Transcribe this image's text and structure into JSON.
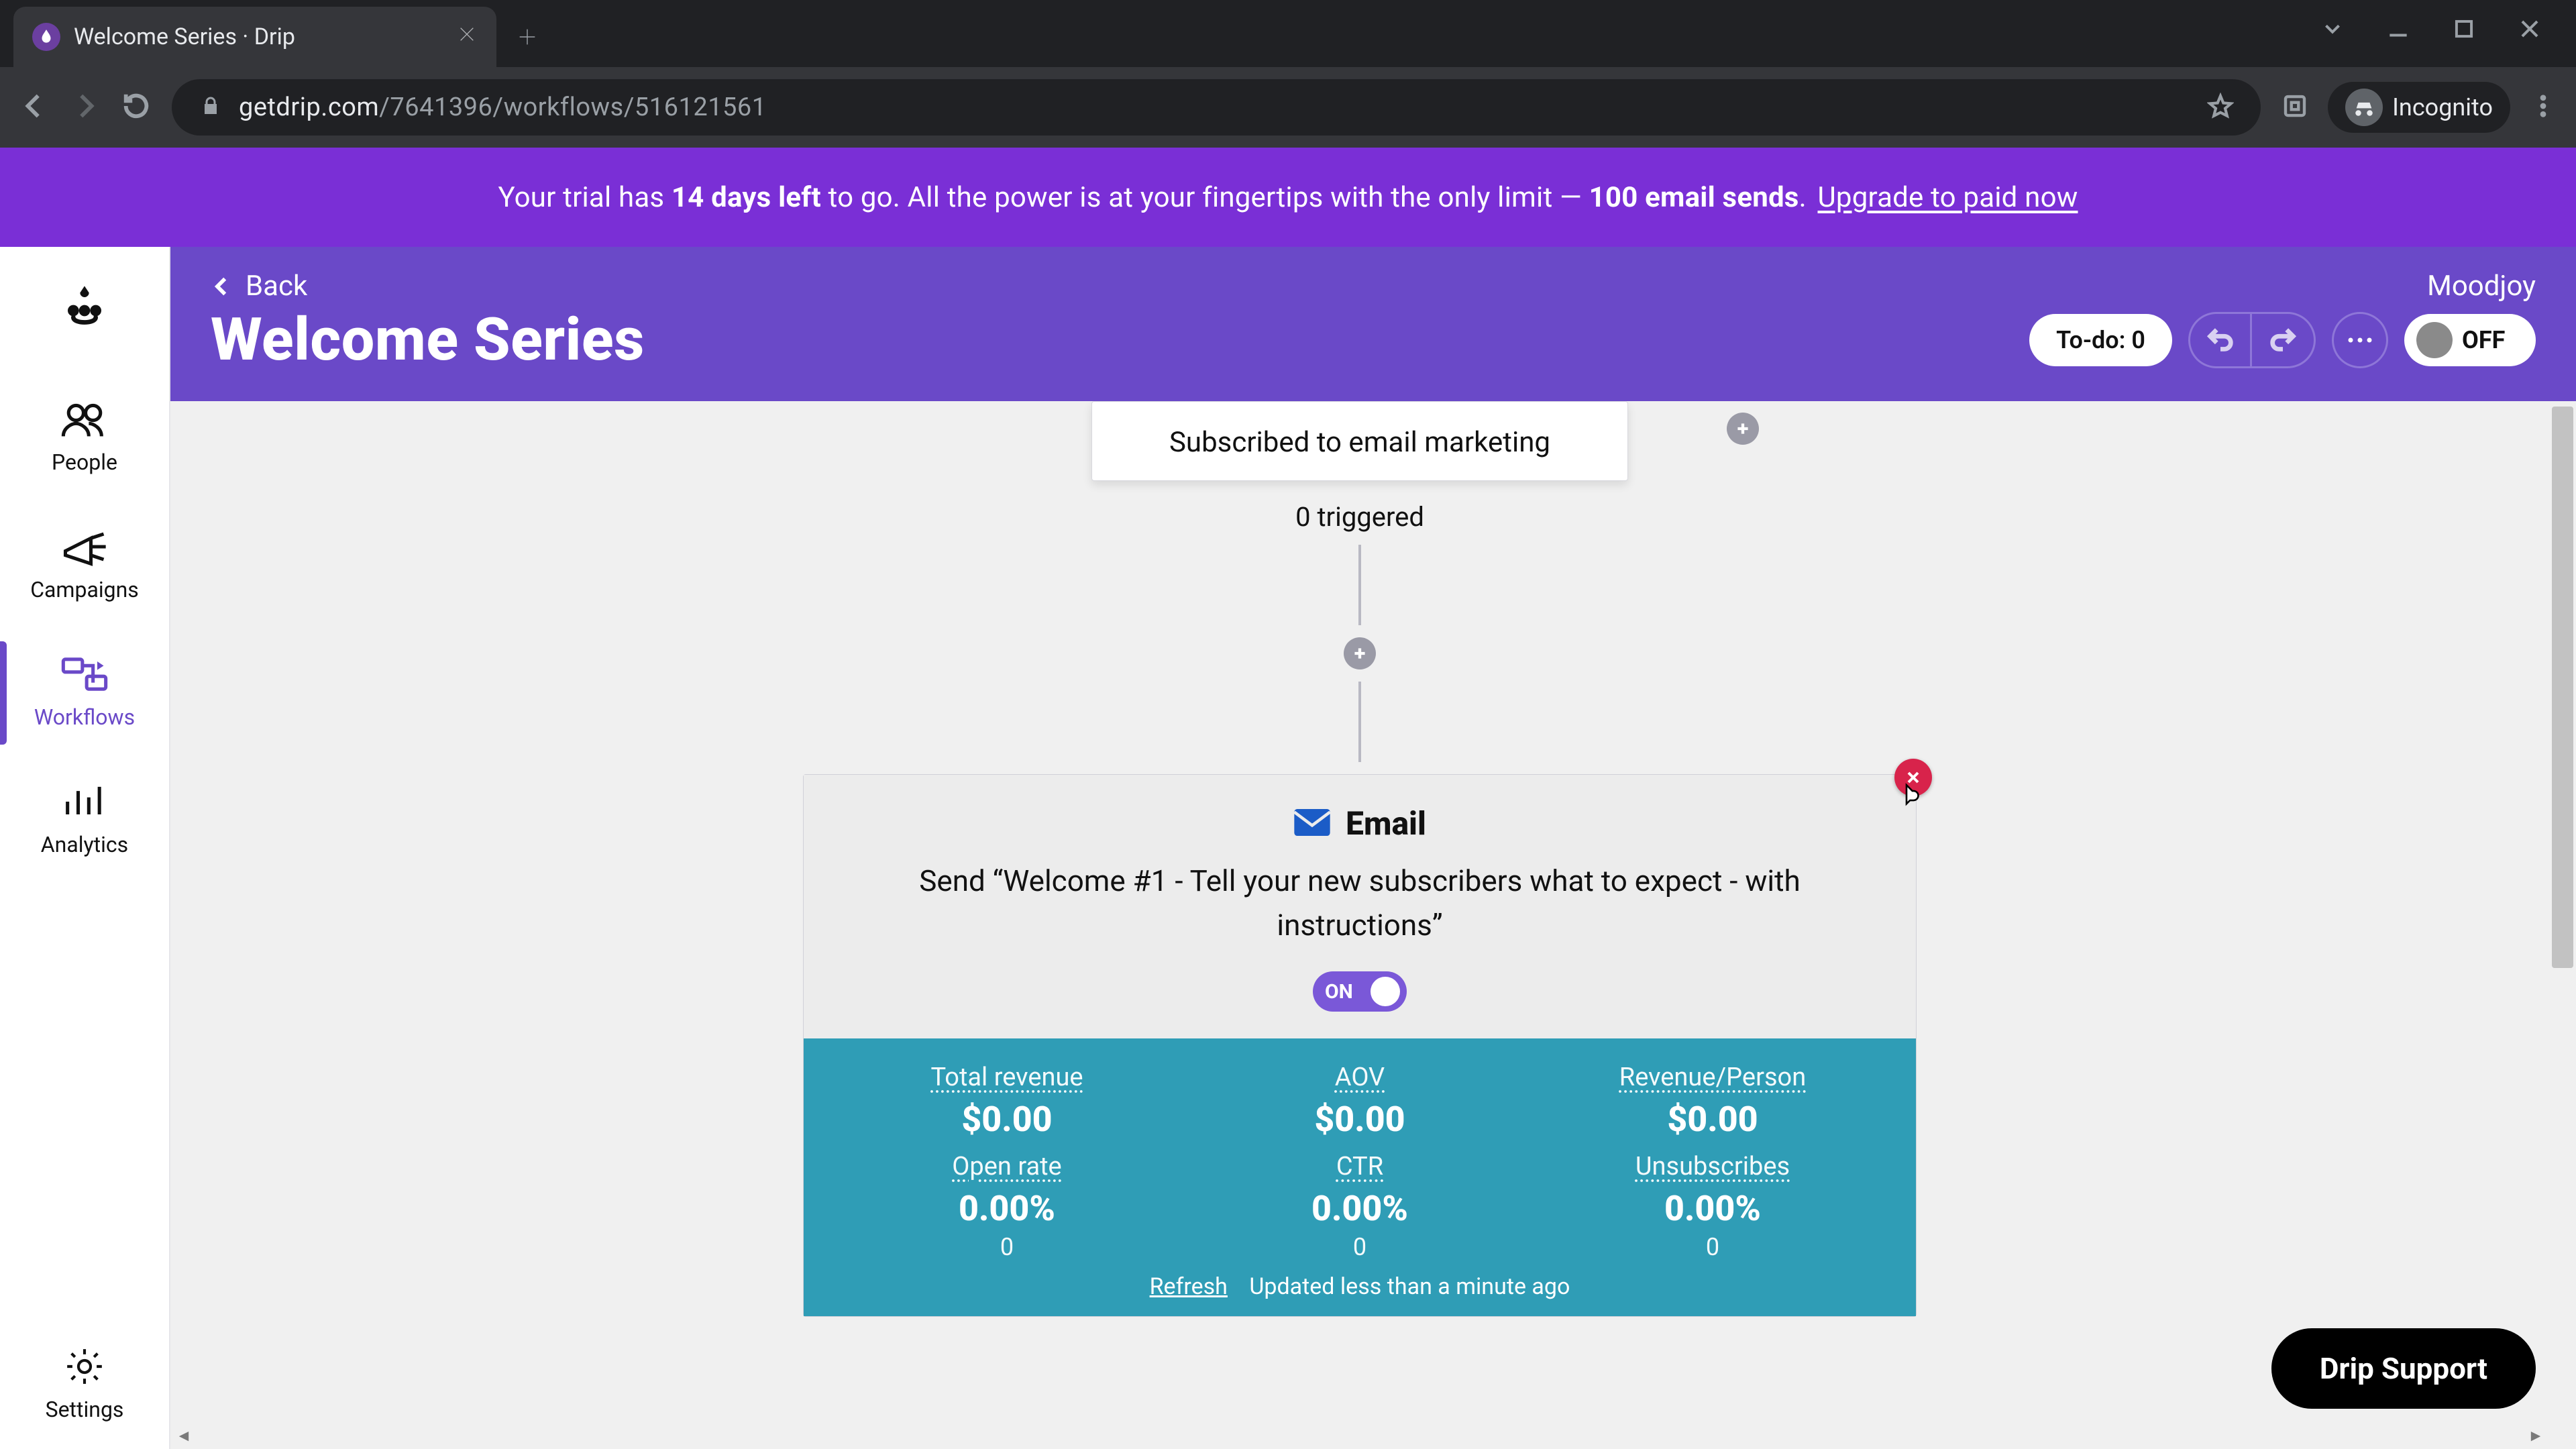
{
  "browser": {
    "tab_title": "Welcome Series · Drip",
    "url_host": "getdrip.com",
    "url_path": "/7641396/workflows/516121561",
    "incognito_label": "Incognito"
  },
  "banner": {
    "pre": "Your trial has ",
    "bold1": "14 days left",
    "mid": " to go. All the power is at your fingertips with the only limit — ",
    "bold2": "100 email sends",
    "post": ". ",
    "link": "Upgrade to paid now"
  },
  "rail": {
    "people": "People",
    "campaigns": "Campaigns",
    "workflows": "Workflows",
    "analytics": "Analytics",
    "settings": "Settings"
  },
  "header": {
    "back": "Back",
    "account": "Moodjoy",
    "title": "Welcome Series",
    "todo": "To-do: 0",
    "toggle_label": "OFF"
  },
  "trigger": {
    "desc": "Subscribed to email marketing",
    "count": "0 triggered"
  },
  "email": {
    "label": "Email",
    "send_pre": "Send “",
    "send_name": "Welcome #1 - Tell your new subscribers what to expect - with instructions",
    "send_post": "”",
    "toggle": "ON"
  },
  "stats": {
    "row1": [
      {
        "k": "Total revenue",
        "v": "$0.00"
      },
      {
        "k": "AOV",
        "v": "$0.00"
      },
      {
        "k": "Revenue/Person",
        "v": "$0.00"
      }
    ],
    "row2": [
      {
        "k": "Open rate",
        "v": "0.00%",
        "sub": "0"
      },
      {
        "k": "CTR",
        "v": "0.00%",
        "sub": "0"
      },
      {
        "k": "Unsubscribes",
        "v": "0.00%",
        "sub": "0"
      }
    ],
    "refresh": "Refresh",
    "updated": "Updated less than a minute ago"
  },
  "support": "Drip Support"
}
